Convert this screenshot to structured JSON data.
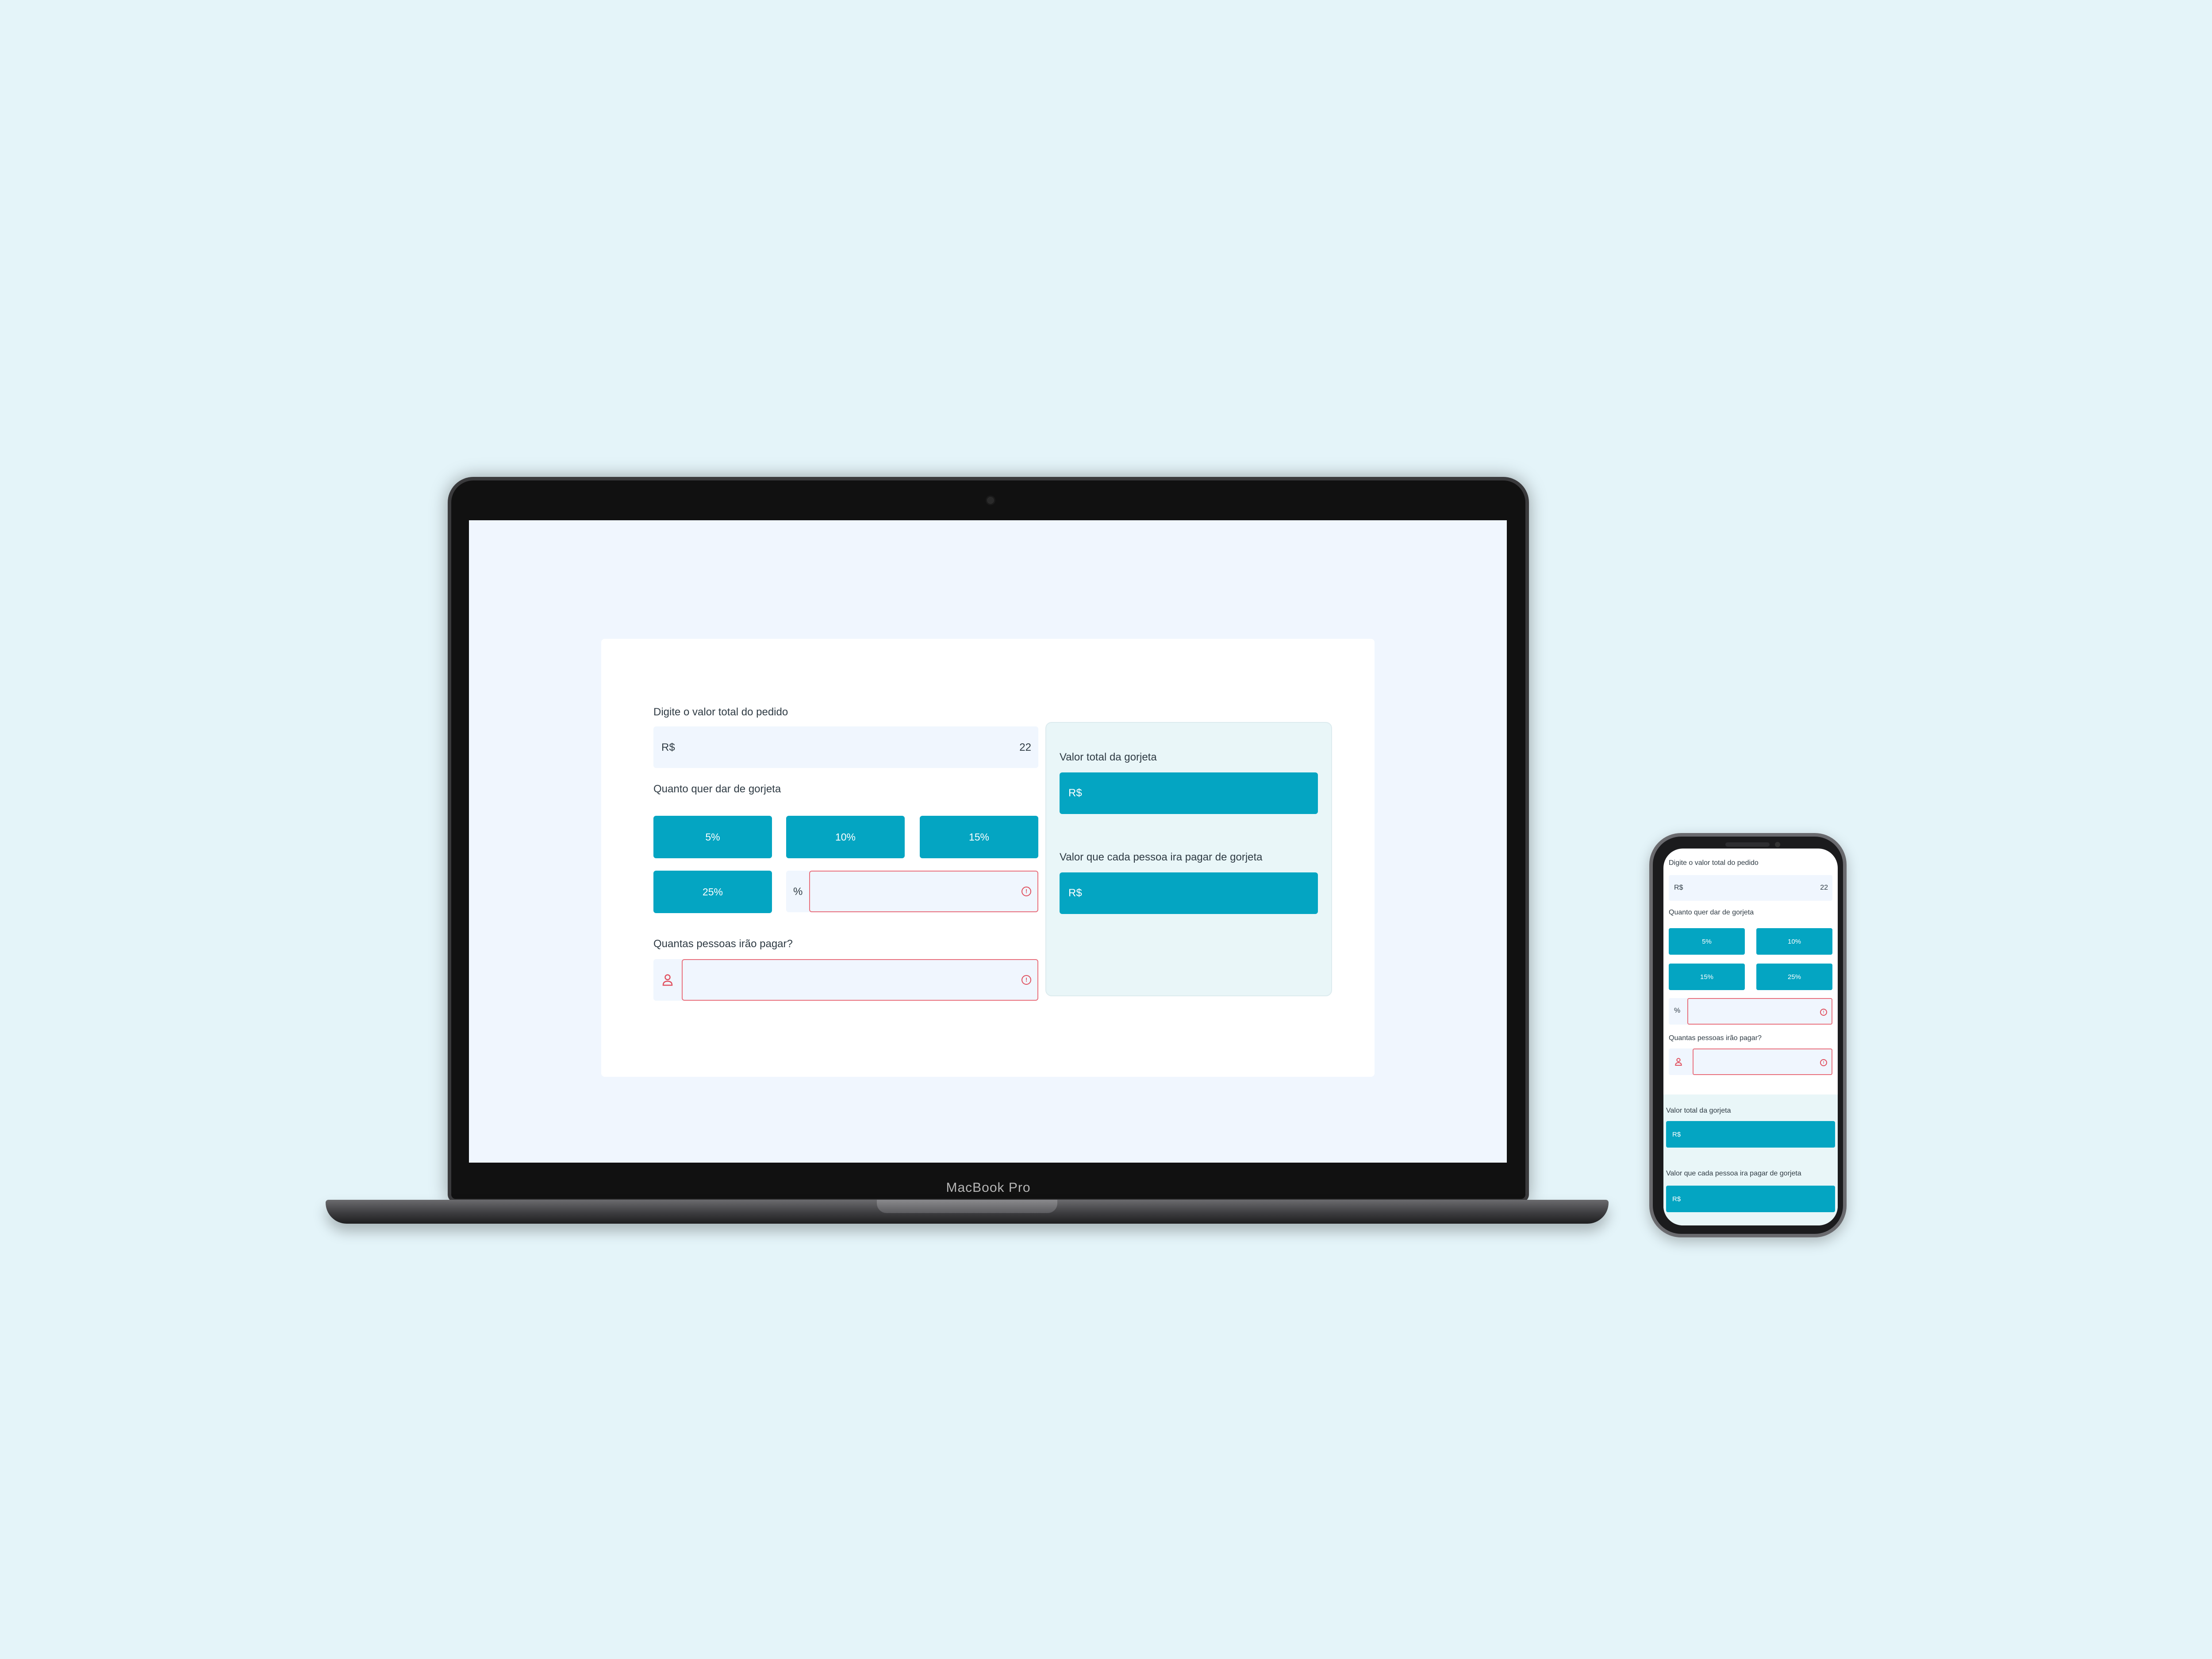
{
  "laptop": {
    "brand": "MacBook Pro"
  },
  "app": {
    "order_label": "Digite o valor total do pedido",
    "currency_prefix": "R$",
    "order_value": "22",
    "tip_label": "Quanto quer dar de gorjeta",
    "tip_options": [
      "5%",
      "10%",
      "15%",
      "25%"
    ],
    "custom_tip_prefix": "%",
    "custom_tip_value": "",
    "people_label": "Quantas pessoas irão pagar?",
    "people_value": "",
    "error_icon": "!",
    "result": {
      "total_label": "Valor total da gorjeta",
      "total_value": "R$",
      "per_person_label": "Valor que cada pessoa ira pagar de gorjeta",
      "per_person_value": "R$"
    }
  },
  "colors": {
    "background": "#e4f4f9",
    "accent": "#04a5c2",
    "error": "#e0505f",
    "field_bg": "#f0f6fe",
    "panel_bg": "#e9f6f8"
  },
  "icons": {
    "person": "person-icon",
    "error": "alert-circle-icon"
  }
}
